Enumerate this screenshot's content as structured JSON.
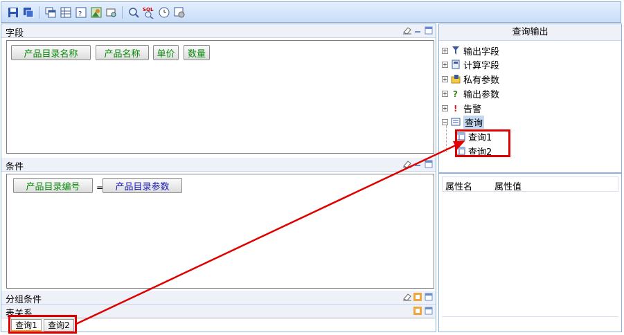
{
  "toolbar": {
    "icons": [
      "save-icon",
      "save-as-icon",
      "window-icon",
      "grid-icon",
      "question-icon",
      "image-icon",
      "print-preview-icon",
      "search-icon",
      "sql-icon",
      "clock-icon",
      "settings-icon"
    ],
    "sql_text": "SQL"
  },
  "fields_pane": {
    "title": "字段",
    "chips": [
      "产品目录名称",
      "产品名称",
      "单价",
      "数量"
    ]
  },
  "conditions_pane": {
    "title": "条件",
    "left_operand": "产品目录编号",
    "operator": "=",
    "right_operand": "产品目录参数"
  },
  "group_pane": {
    "title": "分组条件"
  },
  "relation_pane": {
    "title": "表关系",
    "tabs": [
      "查询1",
      "查询2"
    ]
  },
  "query_output": {
    "title": "查询输出",
    "nodes": [
      {
        "label": "输出字段",
        "icon": "filter-icon"
      },
      {
        "label": "计算字段",
        "icon": "calculator-icon"
      },
      {
        "label": "私有参数",
        "icon": "private-param-icon"
      },
      {
        "label": "输出参数",
        "icon": "question-icon"
      },
      {
        "label": "告警",
        "icon": "alert-icon"
      },
      {
        "label": "查询",
        "icon": "query-icon"
      }
    ],
    "children": [
      "查询1",
      "查询2"
    ]
  },
  "properties": {
    "col_name": "属性名",
    "col_value": "属性值"
  },
  "colors": {
    "highlight": "#e00000",
    "accent": "#8eb0dc"
  }
}
